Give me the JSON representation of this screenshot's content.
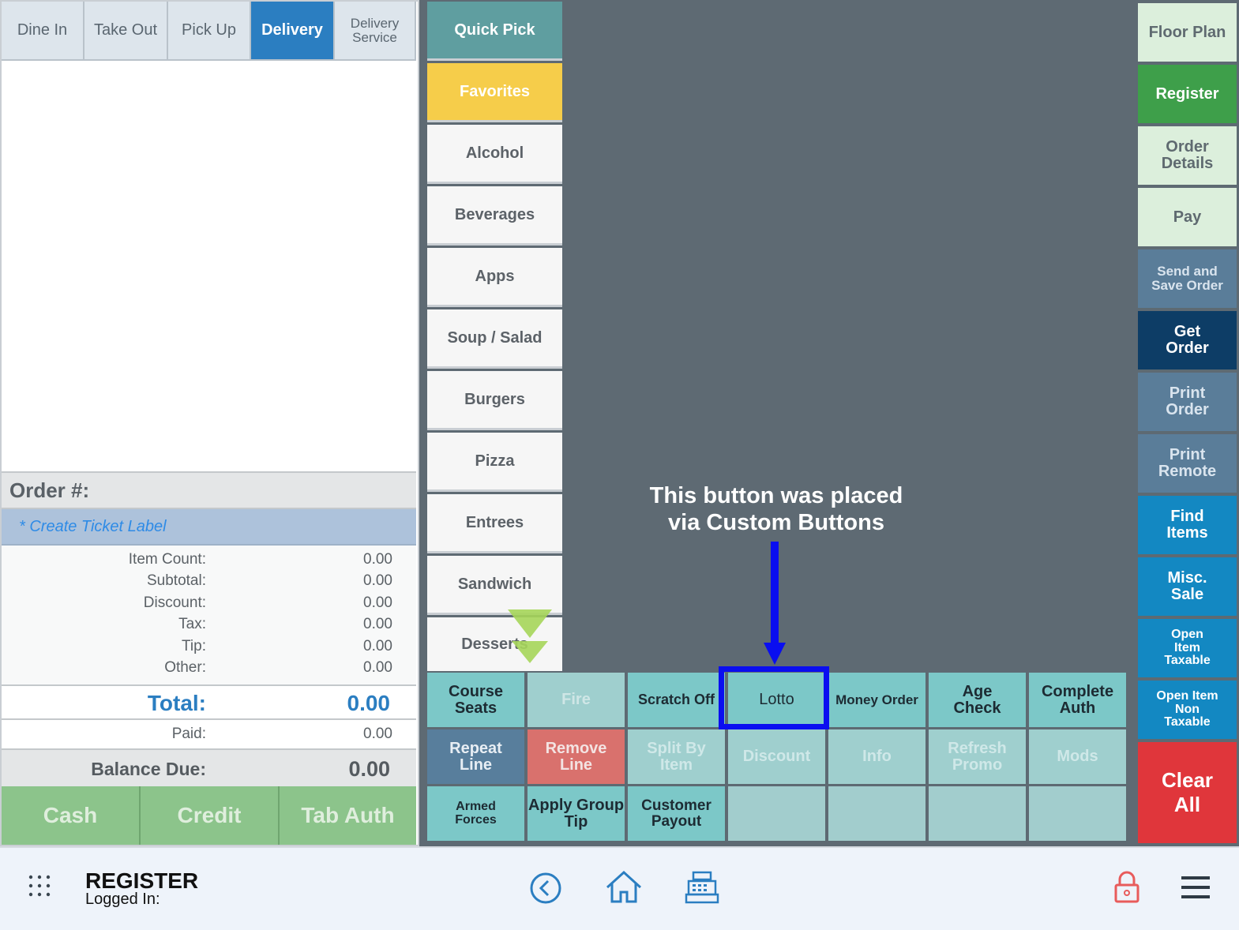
{
  "order_types": [
    {
      "label": "Dine In",
      "active": false
    },
    {
      "label": "Take Out",
      "active": false
    },
    {
      "label": "Pick Up",
      "active": false
    },
    {
      "label": "Delivery",
      "active": true
    },
    {
      "label": "Delivery Service",
      "active": false
    }
  ],
  "order": {
    "header": "Order #:",
    "ticket_label": "* Create Ticket Label",
    "totals": [
      {
        "label": "Item Count:",
        "value": "0.00"
      },
      {
        "label": "Subtotal:",
        "value": "0.00"
      },
      {
        "label": "Discount:",
        "value": "0.00"
      },
      {
        "label": "Tax:",
        "value": "0.00"
      },
      {
        "label": "Tip:",
        "value": "0.00"
      },
      {
        "label": "Other:",
        "value": "0.00"
      }
    ],
    "total_label": "Total:",
    "total_value": "0.00",
    "paid_label": "Paid:",
    "paid_value": "0.00",
    "balance_label": "Balance Due:",
    "balance_value": "0.00"
  },
  "payment_buttons": [
    "Cash",
    "Credit",
    "Tab Auth"
  ],
  "categories": [
    "Quick Pick",
    "Favorites",
    "Alcohol",
    "Beverages",
    "Apps",
    "Soup / Salad",
    "Burgers",
    "Pizza",
    "Entrees",
    "Sandwich",
    "Desserts"
  ],
  "grid": {
    "row1": [
      "Course Seats",
      "Fire",
      "Scratch Off",
      "Lotto",
      "Money Order",
      "Age Check",
      "Complete Auth"
    ],
    "row2": [
      "Repeat Line",
      "Remove Line",
      "Split By Item",
      "Discount",
      "Info",
      "Refresh Promo",
      "Mods"
    ],
    "row3": [
      "Armed Forces",
      "Apply Group Tip",
      "Customer Payout",
      "",
      "",
      "",
      ""
    ]
  },
  "right_buttons": [
    "Floor Plan",
    "Register",
    "Order Details",
    "Pay",
    "Send and Save Order",
    "Get Order",
    "Print Order",
    "Print Remote",
    "Find Items",
    "Misc. Sale",
    "Open Item Taxable",
    "Open Item Non Taxable",
    "Clear All"
  ],
  "annotation": {
    "line1": "This button was placed",
    "line2": "via Custom Buttons"
  },
  "bottom_bar": {
    "title": "REGISTER",
    "logged_in": "Logged In:",
    "icons": [
      "apps-grid-icon",
      "back-circle-icon",
      "home-icon",
      "cash-register-icon",
      "lock-icon",
      "hamburger-menu-icon"
    ]
  },
  "colors": {
    "accent_blue": "#2b7ec1",
    "teal": "#7cc8c8",
    "clear_red": "#e0363b",
    "register_green": "#3e9f4a",
    "annotation_blue": "#0a0ef0"
  }
}
